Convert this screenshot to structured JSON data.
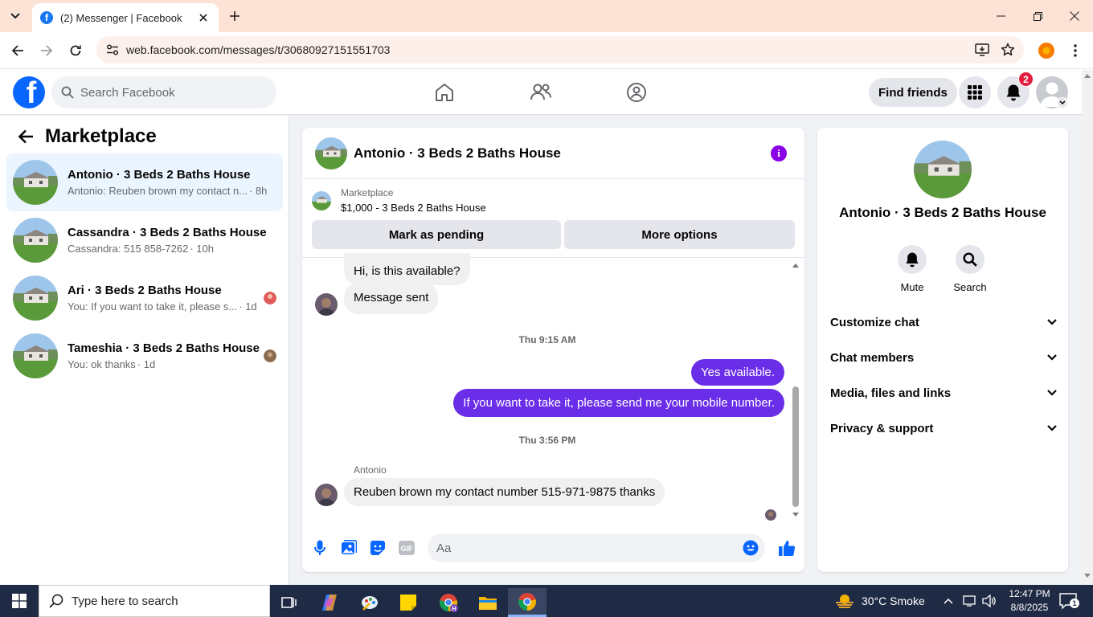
{
  "browser": {
    "tab_title": "(2) Messenger | Facebook",
    "url": "web.facebook.com/messages/t/30680927151551703"
  },
  "header": {
    "search_placeholder": "Search Facebook",
    "find_friends": "Find friends",
    "notification_count": "2"
  },
  "sidebar": {
    "title": "Marketplace",
    "conversations": [
      {
        "name": "Antonio · 3 Beds 2 Baths House",
        "preview": "Antonio: Reuben brown my contact n...",
        "time": "· 8h"
      },
      {
        "name": "Cassandra · 3 Beds 2 Baths House",
        "preview": "Cassandra: 515 858-7262",
        "time": "· 10h"
      },
      {
        "name": "Ari · 3 Beds 2 Baths House",
        "preview": "You: If you want to take it, please s...",
        "time": "· 1d"
      },
      {
        "name": "Tameshia · 3 Beds 2 Baths House",
        "preview": "You: ok thanks",
        "time": "· 1d"
      }
    ]
  },
  "chat": {
    "title": "Antonio · 3 Beds 2 Baths House",
    "listing_category": "Marketplace",
    "listing_title": "$1,000 - 3 Beds 2 Baths House",
    "mark_pending": "Mark as pending",
    "more_options": "More options",
    "messages": {
      "m1": "Hi, is this available?",
      "m2": "Message sent",
      "ts1": "Thu 9:15 AM",
      "m3": "Yes available.",
      "m4": "If you want to take it, please send me your mobile number.",
      "ts2": "Thu 3:56 PM",
      "sender": "Antonio",
      "m5": "Reuben brown my contact number 515-971-9875 thanks"
    },
    "composer_placeholder": "Aa"
  },
  "details": {
    "name": "Antonio · 3 Beds 2 Baths House",
    "mute": "Mute",
    "search": "Search",
    "sections": [
      "Customize chat",
      "Chat members",
      "Media, files and links",
      "Privacy & support"
    ]
  },
  "taskbar": {
    "search_placeholder": "Type here to search",
    "weather": "30°C  Smoke",
    "time": "12:47 PM",
    "date": "8/8/2025",
    "notifications": "1"
  },
  "colors": {
    "fb_blue": "#0866ff",
    "outgoing_bubble": "#6a2ee8",
    "active_conversation": "#ebf5ff"
  }
}
